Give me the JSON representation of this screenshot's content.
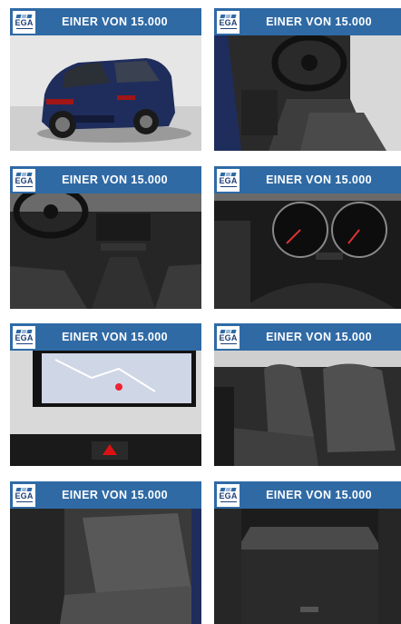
{
  "logo_text": "EGA",
  "banner_text": "EINER VON 15.000",
  "tiles": [
    {
      "subject": "car-exterior-rear"
    },
    {
      "subject": "driver-seat-steering"
    },
    {
      "subject": "dashboard-console"
    },
    {
      "subject": "instrument-cluster"
    },
    {
      "subject": "navigation-screen"
    },
    {
      "subject": "front-seats"
    },
    {
      "subject": "rear-seats"
    },
    {
      "subject": "trunk"
    }
  ],
  "colors": {
    "banner": "#2f6aa5",
    "logo_text": "#1d3f78",
    "car_body": "#1f2d5c"
  }
}
